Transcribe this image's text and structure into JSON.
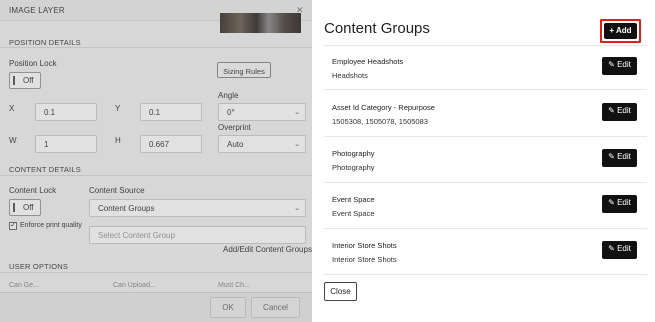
{
  "dialog": {
    "title": "IMAGE LAYER",
    "close_glyph": "✕",
    "sections": {
      "position": "POSITION DETAILS",
      "content": "CONTENT DETAILS",
      "user": "USER OPTIONS"
    },
    "position_lock": {
      "label": "Position Lock",
      "value": "Off"
    },
    "sizing_rules_label": "Sizing Rules",
    "angle": {
      "label": "Angle",
      "value": "0°"
    },
    "x": {
      "label": "X",
      "value": "0.1"
    },
    "y": {
      "label": "Y",
      "value": "0.1"
    },
    "w": {
      "label": "W",
      "value": "1"
    },
    "h": {
      "label": "H",
      "value": "0.667"
    },
    "overprint": {
      "label": "Overprint",
      "value": "Auto"
    },
    "content_lock": {
      "label": "Content Lock",
      "value": "Off"
    },
    "enforce_print_quality": {
      "label": "Enforce print quality",
      "checked": true,
      "glyph": "✓"
    },
    "content_source": {
      "label": "Content Source",
      "value": "Content Groups"
    },
    "content_group_placeholder": "Select Content Group",
    "add_edit_link": "Add/Edit Content Groups",
    "user_cutoff": [
      "Can Ge...",
      "Can Upload...",
      "Must Ch..."
    ],
    "ok_label": "OK",
    "cancel_label": "Cancel",
    "chevron_glyph": "⌄"
  },
  "panel": {
    "title": "Content Groups",
    "add_label": "Add",
    "add_glyph": "+",
    "edit_label": "Edit",
    "edit_glyph": "✎",
    "close_label": "Close",
    "groups": [
      {
        "name": "Employee Headshots",
        "sub": "Headshots"
      },
      {
        "name": "Asset Id Category - Repurpose",
        "sub": "1505308, 1505078, 1505083"
      },
      {
        "name": "Photography",
        "sub": "Photography"
      },
      {
        "name": "Event Space",
        "sub": "Event Space"
      },
      {
        "name": "Interior Store Shots",
        "sub": "Interior Store Shots"
      }
    ]
  }
}
